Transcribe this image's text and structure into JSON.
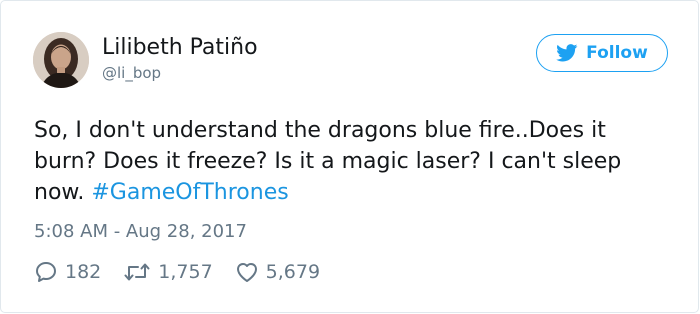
{
  "user": {
    "display_name": "Lilibeth Patiño",
    "handle": "@li_bop",
    "avatar_icon": "profile-photo"
  },
  "follow_button": {
    "label": "Follow",
    "icon": "twitter-bird-icon",
    "color": "#1da1f2"
  },
  "tweet": {
    "text_before": "So, I don't understand the dragons blue fire..Does it burn? Does it freeze? Is it a magic laser? I can't sleep now. ",
    "hashtag": "#GameOfThrones",
    "timestamp": "5:08 AM - Aug 28, 2017"
  },
  "actions": {
    "replies": "182",
    "retweets": "1,757",
    "likes": "5,679"
  },
  "colors": {
    "text": "#14171a",
    "secondary": "#657786",
    "link": "#1b95e0",
    "border": "#e1e8ed"
  }
}
